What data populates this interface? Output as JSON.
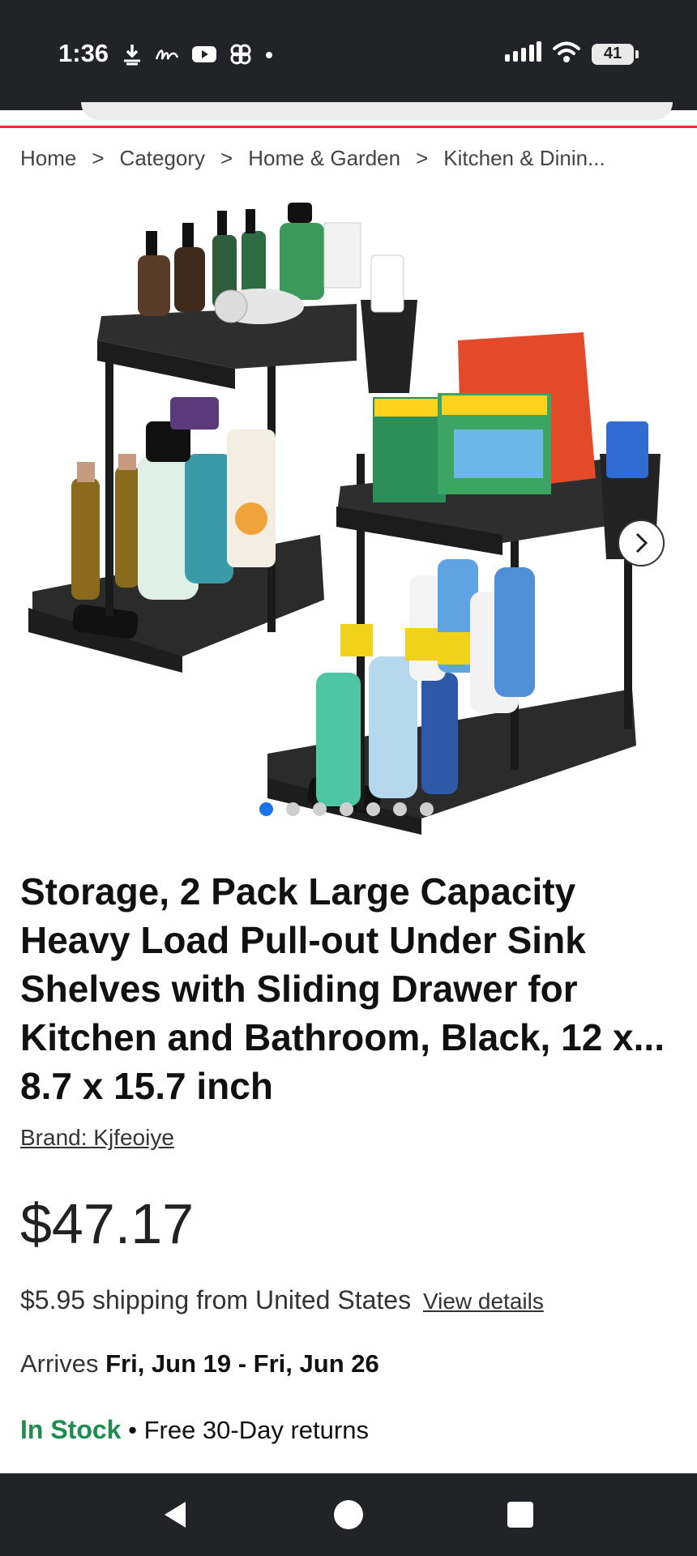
{
  "status_bar": {
    "time": "1:36",
    "battery": "41",
    "left_icons": [
      "download-icon",
      "fliqe-icon",
      "youtube-icon",
      "pinwheel-icon",
      "dot-icon"
    ],
    "right_icons": [
      "signal-icon",
      "wifi-icon",
      "battery-icon"
    ]
  },
  "breadcrumb": {
    "items": [
      "Home",
      "Category",
      "Home & Garden",
      "Kitchen & Dinin..."
    ],
    "separator": ">"
  },
  "carousel": {
    "total_images": 7,
    "active_index": 0
  },
  "product": {
    "title": "Storage, 2 Pack Large Capacity Heavy Load Pull-out Under Sink Shelves with Sliding Drawer for Kitchen and Bathroom, Black, 12 x... 8.7 x 15.7 inch",
    "title_lines": [
      "Storage, 2 Pack Large Capacity",
      "Heavy Load Pull-out Under Sink",
      "Shelves with Sliding Drawer for",
      "Kitchen and Bathroom, Black, 12 x...",
      "8.7 x 15.7 inch"
    ],
    "brand": "Brand: Kjfeoiye",
    "price": "$47.17",
    "shipping_cost": "$5.95",
    "shipping_text": "shipping from United States",
    "view_details": "View details",
    "arrives_label": "Arrives",
    "arrives_dates": "Fri, Jun 19 - Fri, Jun 26",
    "stock": "In Stock",
    "bullet": "•",
    "returns": "Free 30-Day returns"
  },
  "colors": {
    "accent_red": "#e53238",
    "stock_green": "#1e8c4e",
    "active_dot": "#1a73e8",
    "system_bar": "#222327"
  }
}
